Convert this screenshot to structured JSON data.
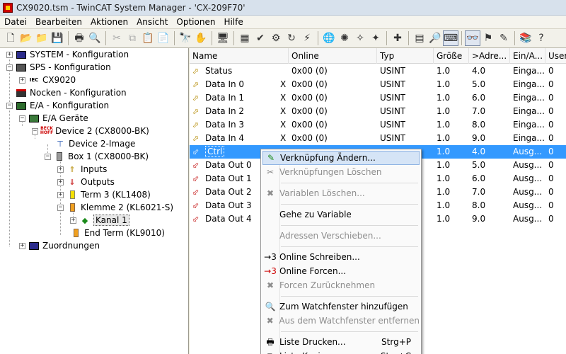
{
  "window": {
    "title": "CX9020.tsm - TwinCAT System Manager - 'CX-209F70'"
  },
  "menu": [
    "Datei",
    "Bearbeiten",
    "Aktionen",
    "Ansicht",
    "Optionen",
    "Hilfe"
  ],
  "tree": {
    "items": [
      {
        "label": "SYSTEM - Konfiguration",
        "icon": "system-config-icon"
      },
      {
        "label": "SPS - Konfiguration",
        "icon": "plc-config-icon"
      },
      {
        "label": "CX9020",
        "icon": "iec-project-icon"
      },
      {
        "label": "Nocken - Konfiguration",
        "icon": "cam-config-icon"
      },
      {
        "label": "E/A - Konfiguration",
        "icon": "io-config-icon"
      },
      {
        "label": "E/A Geräte",
        "icon": "io-devices-icon"
      },
      {
        "label": "Device 2 (CX8000-BK)",
        "icon": "beckhoff-device-icon"
      },
      {
        "label": "Device 2-Image",
        "icon": "image-icon"
      },
      {
        "label": "Box 1 (CX8000-BK)",
        "icon": "box-icon"
      },
      {
        "label": "Inputs",
        "icon": "inputs-icon"
      },
      {
        "label": "Outputs",
        "icon": "outputs-icon"
      },
      {
        "label": "Term 3 (KL1408)",
        "icon": "terminal-icon"
      },
      {
        "label": "Klemme 2 (KL6021-S)",
        "icon": "terminal-icon"
      },
      {
        "label": "Kanal 1",
        "icon": "channel-icon"
      },
      {
        "label": "End Term (KL9010)",
        "icon": "end-terminal-icon"
      },
      {
        "label": "Zuordnungen",
        "icon": "mappings-icon"
      }
    ],
    "iec_badge": "IEC",
    "beck_badge": "BECK",
    "hoff_badge": "HOFF"
  },
  "list": {
    "columns": [
      "Name",
      "Online",
      "Typ",
      "Größe",
      ">Adre...",
      "Ein/A...",
      "User"
    ],
    "rows": [
      {
        "name": "Status",
        "x": "",
        "online": "0x00 (0)",
        "typ": "USINT",
        "size": "1.0",
        "addr": "4.0",
        "io": "Einga...",
        "user": "0",
        "dir": "in"
      },
      {
        "name": "Data In 0",
        "x": "X",
        "online": "0x00 (0)",
        "typ": "USINT",
        "size": "1.0",
        "addr": "5.0",
        "io": "Einga...",
        "user": "0",
        "dir": "in"
      },
      {
        "name": "Data In 1",
        "x": "X",
        "online": "0x00 (0)",
        "typ": "USINT",
        "size": "1.0",
        "addr": "6.0",
        "io": "Einga...",
        "user": "0",
        "dir": "in"
      },
      {
        "name": "Data In 2",
        "x": "X",
        "online": "0x00 (0)",
        "typ": "USINT",
        "size": "1.0",
        "addr": "7.0",
        "io": "Einga...",
        "user": "0",
        "dir": "in"
      },
      {
        "name": "Data In 3",
        "x": "X",
        "online": "0x00 (0)",
        "typ": "USINT",
        "size": "1.0",
        "addr": "8.0",
        "io": "Einga...",
        "user": "0",
        "dir": "in"
      },
      {
        "name": "Data In 4",
        "x": "X",
        "online": "0x00 (0)",
        "typ": "USINT",
        "size": "1.0",
        "addr": "9.0",
        "io": "Einga...",
        "user": "0",
        "dir": "in"
      },
      {
        "name": "Ctrl",
        "x": "",
        "online": "",
        "typ": "",
        "size": "1.0",
        "addr": "4.0",
        "io": "Ausg...",
        "user": "0",
        "dir": "out"
      },
      {
        "name": "Data Out 0",
        "x": "",
        "online": "",
        "typ": "",
        "size": "1.0",
        "addr": "5.0",
        "io": "Ausg...",
        "user": "0",
        "dir": "out"
      },
      {
        "name": "Data Out 1",
        "x": "",
        "online": "",
        "typ": "",
        "size": "1.0",
        "addr": "6.0",
        "io": "Ausg...",
        "user": "0",
        "dir": "out"
      },
      {
        "name": "Data Out 2",
        "x": "",
        "online": "",
        "typ": "",
        "size": "1.0",
        "addr": "7.0",
        "io": "Ausg...",
        "user": "0",
        "dir": "out"
      },
      {
        "name": "Data Out 3",
        "x": "",
        "online": "",
        "typ": "",
        "size": "1.0",
        "addr": "8.0",
        "io": "Ausg...",
        "user": "0",
        "dir": "out"
      },
      {
        "name": "Data Out 4",
        "x": "",
        "online": "",
        "typ": "",
        "size": "1.0",
        "addr": "9.0",
        "io": "Ausg...",
        "user": "0",
        "dir": "out"
      }
    ]
  },
  "context_menu": {
    "items": [
      {
        "label": "Verknüpfung Ändern...",
        "icon": "link-change-icon",
        "state": "hover"
      },
      {
        "label": "Verknüpfungen Löschen",
        "icon": "link-delete-icon",
        "state": "disabled"
      },
      {
        "label": "Variablen Löschen...",
        "icon": "variable-delete-icon",
        "state": "disabled"
      },
      {
        "label": "Gehe zu Variable",
        "icon": "",
        "state": "normal"
      },
      {
        "label": "Adressen Verschieben...",
        "icon": "",
        "state": "disabled"
      },
      {
        "label": "Online Schreiben...",
        "icon": "online-write-icon",
        "state": "normal"
      },
      {
        "label": "Online Forcen...",
        "icon": "online-force-icon",
        "state": "normal"
      },
      {
        "label": "Forcen Zurücknehmen",
        "icon": "force-release-icon",
        "state": "disabled"
      },
      {
        "label": "Zum Watchfenster hinzufügen",
        "icon": "watch-add-icon",
        "state": "normal"
      },
      {
        "label": "Aus dem Watchfenster entfernen",
        "icon": "watch-remove-icon",
        "state": "disabled"
      },
      {
        "label": "Liste Drucken...",
        "icon": "print-list-icon",
        "state": "normal",
        "shortcut": "Strg+P"
      },
      {
        "label": "Liste Kopieren",
        "icon": "copy-list-icon",
        "state": "normal",
        "shortcut": "Strg+C"
      }
    ]
  },
  "colors": {
    "selection": "#3399ff",
    "menu_hover": "#d5e4f6"
  }
}
